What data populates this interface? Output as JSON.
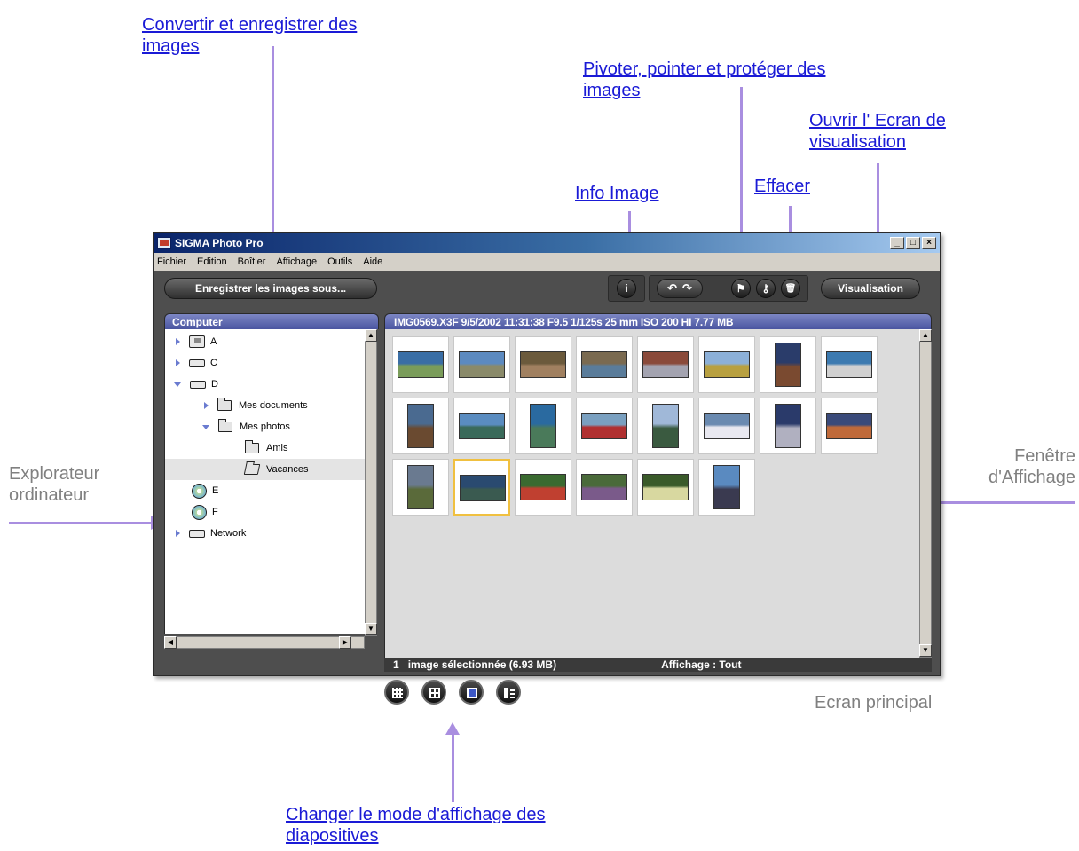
{
  "callouts": {
    "convertir_line1": "Convertir et enregistrer des",
    "convertir_line2": "images",
    "pivoter_line1": "Pivoter, pointer et protéger des",
    "pivoter_line2": "images",
    "ouvrir_line1": "Ouvrir l' Ecran de",
    "ouvrir_line2": "visualisation",
    "info_image": "Info Image",
    "effacer": "Effacer",
    "changer_line1": "Changer le mode d'affichage des",
    "changer_line2": "diapositives"
  },
  "notes": {
    "explorateur_line1": "Explorateur",
    "explorateur_line2": "ordinateur",
    "fenetre_line1": "Fenêtre",
    "fenetre_line2": "d'Affichage",
    "ecran_principal": "Ecran principal"
  },
  "window": {
    "title": "SIGMA Photo Pro",
    "controls": [
      "_",
      "□",
      "×"
    ]
  },
  "menu": [
    "Fichier",
    "Edition",
    "Boîtier",
    "Affichage",
    "Outils",
    "Aide"
  ],
  "toolbar": {
    "save_label": "Enregistrer les images sous...",
    "info_glyph": "i",
    "rotate_left_glyph": "↶",
    "rotate_right_glyph": "↷",
    "flag_glyph": "⚑",
    "key_glyph": "⚷",
    "trash_glyph": "🗑",
    "view_label": "Visualisation"
  },
  "explorer": {
    "header": "Computer",
    "items": [
      {
        "label": "A",
        "icon": "floppy-icon"
      },
      {
        "label": "C",
        "icon": "hard-drive-icon"
      },
      {
        "label": "D",
        "icon": "hard-drive-icon"
      },
      {
        "label": "Mes documents",
        "icon": "folder-icon"
      },
      {
        "label": "Mes photos",
        "icon": "folder-icon"
      },
      {
        "label": "Amis",
        "icon": "folder-icon"
      },
      {
        "label": "Vacances",
        "icon": "folder-open-icon"
      },
      {
        "label": "E",
        "icon": "cd-icon"
      },
      {
        "label": "F",
        "icon": "cd-icon"
      },
      {
        "label": "Network",
        "icon": "network-drive-icon"
      }
    ]
  },
  "viewer": {
    "info": "IMG0569.X3F  9/5/2002  11:31:38  F9.5  1/125s  25 mm  ISO 200  HI  7.77 MB",
    "status_count": "1",
    "status_selected": "image sélectionnée   (6.93 MB)",
    "status_filter": "Affichage : Tout",
    "thumbnail_count": 22,
    "selected_index": 17
  },
  "colors": {
    "accent": "#a98ee0",
    "link": "#1a1ad6",
    "panel_header": "#5a64ac",
    "selection": "#f0c040"
  }
}
